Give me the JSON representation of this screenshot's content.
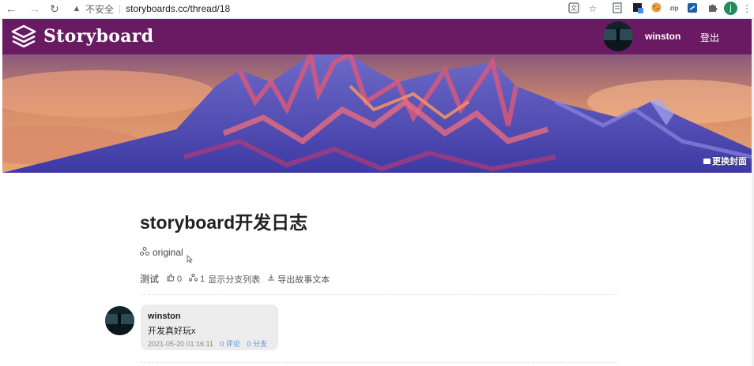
{
  "browser": {
    "back": "←",
    "forward": "→",
    "reload": "↻",
    "security_warning": "不安全",
    "url": "storyboards.cc/thread/18",
    "extensions": [
      "translate-icon",
      "star-icon",
      "doc-icon",
      "box-icon",
      "cookie-icon",
      "zip-icon",
      "s-icon",
      "puzzle-icon"
    ],
    "zip_label": "zip",
    "profile_initial": "j",
    "menu": "⋮"
  },
  "header": {
    "brand": "Storyboard",
    "user_name": "winston",
    "logout": "登出",
    "bg_color": "#6a1a63"
  },
  "cover": {
    "change_cover": "更换封面"
  },
  "thread": {
    "title": "storyboard开发日志",
    "branch": "original",
    "tag": "测试",
    "likes": "0",
    "branch_count": "1",
    "show_branches": "显示分支列表",
    "export": "导出故事文本"
  },
  "comment": {
    "author": "winston",
    "text": "开发真好玩x",
    "timestamp": "2021-05-20 01:16:11",
    "comments": "0 评论",
    "branches": "0 分支"
  }
}
